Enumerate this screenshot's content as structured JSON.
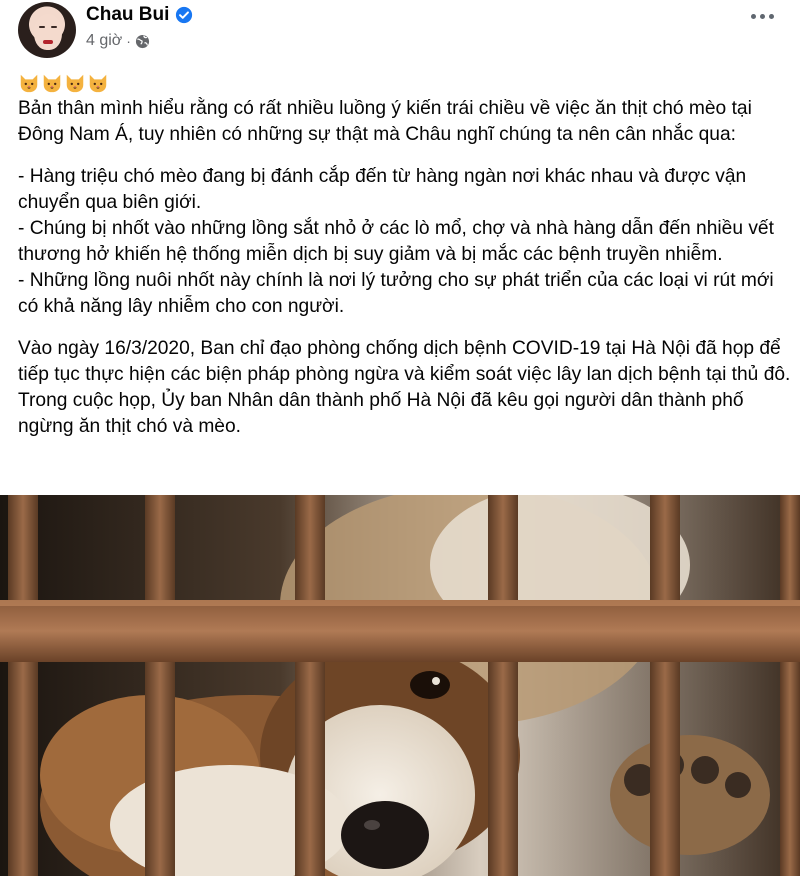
{
  "post": {
    "author": "Chau Bui",
    "time": "4 giờ",
    "separator": "·",
    "emojis": [
      "cat-face",
      "cat-face",
      "cat-face",
      "cat-face"
    ],
    "paragraph_1": "Bản thân mình hiểu rằng có rất nhiều luồng ý kiến trái chiều về việc ăn thịt chó mèo tại Đông Nam Á, tuy nhiên có những sự thật mà Châu nghĩ chúng ta nên cân nhắc qua:",
    "bullet_1": "- Hàng triệu chó mèo đang bị đánh cắp đến từ hàng ngàn nơi khác nhau và được vận chuyển qua biên giới.",
    "bullet_2": "- Chúng bị nhốt vào những lồng sắt nhỏ ở các lò mổ, chợ và nhà hàng dẫn đến nhiều vết thương hở khiến hệ thống miễn dịch bị suy giảm và bị mắc các bệnh truyền nhiễm.",
    "bullet_3": "- Những lồng nuôi nhốt này chính là nơi lý tưởng cho sự phát triển của các loại vi rút mới có khả năng lây nhiễm cho con người.",
    "paragraph_2": "Vào ngày 16/3/2020, Ban chỉ đạo phòng chống dịch bệnh COVID-19 tại Hà Nội đã họp để tiếp tục thực hiện các biện pháp phòng ngừa và kiểm soát việc lây lan dịch bệnh tại thủ đô. Trong cuộc họp, Ủy ban Nhân dân thành phố Hà Nội đã kêu gọi người dân thành phố ngừng ăn thịt chó và mèo."
  },
  "icons": {
    "verified": "verified-badge-icon",
    "privacy": "globe-icon",
    "menu": "more-options-icon"
  },
  "colors": {
    "verified_blue": "#1877f2",
    "meta_gray": "#65676b",
    "text": "#050505"
  }
}
